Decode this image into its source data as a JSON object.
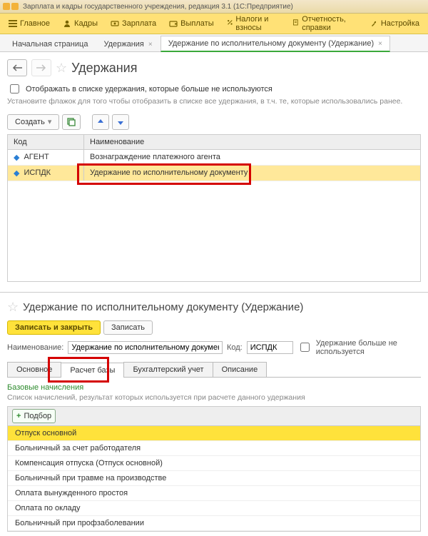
{
  "title_bar": "Зарплата и кадры государственного учреждения, редакция 3.1  (1С:Предприятие)",
  "menu": {
    "main": "Главное",
    "kadry": "Кадры",
    "zarplata": "Зарплата",
    "vyplaty": "Выплаты",
    "nalogi": "Налоги и взносы",
    "otchet": "Отчетность, справки",
    "nastr": "Настройка"
  },
  "tabs": {
    "t0": "Начальная страница",
    "t1": "Удержания",
    "t2": "Удержание по исполнительному документу (Удержание)",
    "x": "×"
  },
  "page1": {
    "title": "Удержания",
    "chk_label": "Отображать в списке удержания, которые больше не используются",
    "hint": "Установите флажок для того чтобы отобразить в списке все удержания, в т.ч. те, которые использовались ранее.",
    "create": "Создать",
    "col_code": "Код",
    "col_name": "Наименование",
    "rows": [
      {
        "code": "АГЕНТ",
        "name": "Вознаграждение платежного агента"
      },
      {
        "code": "ИСПДК",
        "name": "Удержание по исполнительному документу"
      }
    ]
  },
  "page2": {
    "title": "Удержание по исполнительному документу (Удержание)",
    "save_close": "Записать и закрыть",
    "save": "Записать",
    "name_lbl": "Наименование:",
    "name_val": "Удержание по исполнительному документу",
    "code_lbl": "Код:",
    "code_val": "ИСПДК",
    "noused_lbl": "Удержание больше не используется",
    "tabs": {
      "t0": "Основное",
      "t1": "Расчет базы",
      "t2": "Бухгалтерский учет",
      "t3": "Описание"
    },
    "green": "Базовые начисления",
    "hint": "Список начислений, результат которых используется при расчете данного удержания",
    "podbor": "Подбор",
    "list": [
      "Отпуск основной",
      "Больничный за счет работодателя",
      "Компенсация отпуска (Отпуск основной)",
      "Больничный при травме на производстве",
      "Оплата вынужденного простоя",
      "Оплата по окладу",
      "Больничный при профзаболевании"
    ]
  },
  "icons": {
    "plus": "+"
  },
  "chart_data": null
}
